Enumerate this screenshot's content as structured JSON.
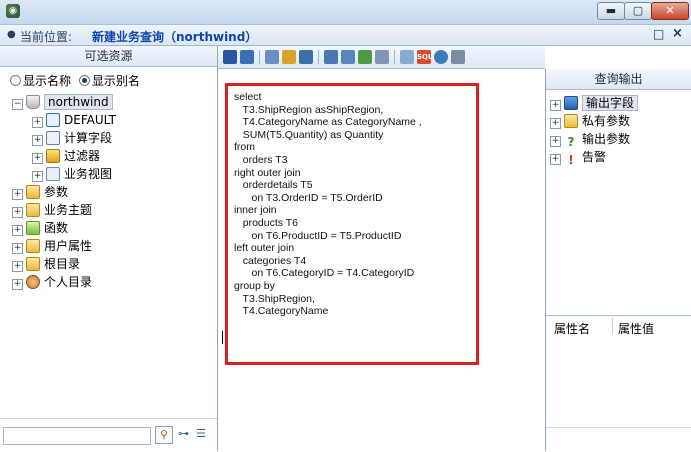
{
  "window": {
    "minimize_glyph": "▬",
    "maximize_glyph": "▢",
    "close_glyph": "✕"
  },
  "location": {
    "label": "当前位置:",
    "value": "新建业务查询（northwind）",
    "maximize_glyph": "□",
    "close_glyph": "×"
  },
  "left_panel": {
    "title": "可选资源",
    "radio_name_label": "显示名称",
    "radio_alias_label": "显示别名",
    "selected_option": "显示别名",
    "tree": [
      {
        "label": "northwind",
        "icon": "database-icon",
        "level": 0,
        "expander": "⊟",
        "selected": true
      },
      {
        "label": "DEFAULT",
        "icon": "table-icon",
        "level": 1,
        "expander": "⊞"
      },
      {
        "label": "计算字段",
        "icon": "calc-field-icon",
        "level": 1,
        "expander": "⊞"
      },
      {
        "label": "过滤器",
        "icon": "filter-icon",
        "level": 1,
        "expander": "⊞"
      },
      {
        "label": "业务视图",
        "icon": "view-icon",
        "level": 1,
        "expander": "⊞"
      },
      {
        "label": "参数",
        "icon": "param-folder-icon",
        "level": 0,
        "expander": "⊞"
      },
      {
        "label": "业务主题",
        "icon": "topic-folder-icon",
        "level": 0,
        "expander": "⊞"
      },
      {
        "label": "函数",
        "icon": "function-folder-icon",
        "level": 0,
        "expander": "⊞"
      },
      {
        "label": "用户属性",
        "icon": "user-prop-folder-icon",
        "level": 0,
        "expander": "⊞"
      },
      {
        "label": "根目录",
        "icon": "folder-icon",
        "level": 0,
        "expander": "⊞"
      },
      {
        "label": "个人目录",
        "icon": "personal-folder-icon",
        "level": 0,
        "expander": "⊞"
      }
    ]
  },
  "toolbar": {
    "icons": [
      "save-icon",
      "save-as-icon",
      "copy-icon",
      "edit-icon",
      "filter-icon",
      "grid-icon",
      "fields-icon",
      "chart-icon",
      "export-icon",
      "zoom-icon",
      "sql-icon",
      "clock-icon",
      "settings-icon"
    ],
    "sql_label": "SQL"
  },
  "editor": {
    "sql": "select\n   T3.ShipRegion asShipRegion,\n   T4.CategoryName as CategoryName ,\n   SUM(T5.Quantity) as Quantity\nfrom\n   orders T3\nright outer join\n   orderdetails T5\n      on T3.OrderID = T5.OrderID\ninner join\n   products T6\n      on T6.ProductID = T5.ProductID\nleft outer join\n   categories T4\n      on T6.CategoryID = T4.CategoryID\ngroup by\n   T3.ShipRegion,\n   T4.CategoryName"
  },
  "right_panel": {
    "title": "查询输出",
    "items": [
      {
        "label": "输出字段",
        "icon": "output-field-icon",
        "expander": "⊞",
        "selected": true
      },
      {
        "label": "私有参数",
        "icon": "private-param-icon",
        "expander": "⊞"
      },
      {
        "label": "输出参数",
        "icon": "output-param-icon",
        "expander": "⊞"
      },
      {
        "label": "告警",
        "icon": "alert-icon",
        "expander": "⊞"
      }
    ],
    "prop_name_header": "属性名",
    "prop_value_header": "属性值"
  },
  "colors": {
    "highlight_border": "#e02020",
    "location_value": "#1144aa"
  }
}
